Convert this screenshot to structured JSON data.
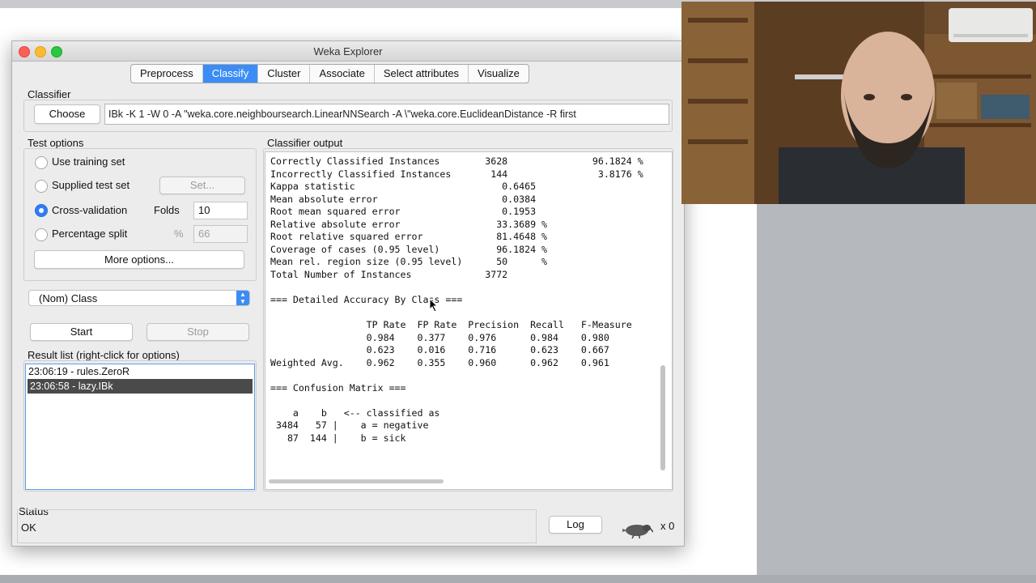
{
  "window": {
    "title": "Weka Explorer"
  },
  "tabs": [
    "Preprocess",
    "Classify",
    "Cluster",
    "Associate",
    "Select attributes",
    "Visualize"
  ],
  "active_tab": "Classify",
  "classifier": {
    "group_label": "Classifier",
    "choose_label": "Choose",
    "command": "IBk -K 1 -W 0 -A \"weka.core.neighboursearch.LinearNNSearch -A \\\"weka.core.EuclideanDistance -R first"
  },
  "test_options": {
    "group_label": "Test options",
    "use_training": "Use training set",
    "supplied_test": "Supplied test set",
    "set_label": "Set...",
    "cross_validation": "Cross-validation",
    "folds_label": "Folds",
    "folds_value": "10",
    "percentage_split": "Percentage split",
    "percent_symbol": "%",
    "percent_value": "66",
    "more_options": "More options...",
    "selected": "cross_validation"
  },
  "class_select": {
    "value": "(Nom) Class"
  },
  "actions": {
    "start": "Start",
    "stop": "Stop"
  },
  "result_list": {
    "label": "Result list (right-click for options)",
    "items": [
      "23:06:19 - rules.ZeroR",
      "23:06:58 - lazy.IBk"
    ],
    "selected_index": 1
  },
  "output": {
    "label": "Classifier output",
    "lines": [
      "Correctly Classified Instances        3628               96.1824 %",
      "Incorrectly Classified Instances       144                3.8176 %",
      "Kappa statistic                          0.6465",
      "Mean absolute error                      0.0384",
      "Root mean squared error                  0.1953",
      "Relative absolute error                 33.3689 %",
      "Root relative squared error             81.4648 %",
      "Coverage of cases (0.95 level)          96.1824 %",
      "Mean rel. region size (0.95 level)      50      %",
      "Total Number of Instances             3772",
      "",
      "=== Detailed Accuracy By Class ===",
      "",
      "                 TP Rate  FP Rate  Precision  Recall   F-Measure",
      "                 0.984    0.377    0.976      0.984    0.980",
      "                 0.623    0.016    0.716      0.623    0.667",
      "Weighted Avg.    0.962    0.355    0.960      0.962    0.961",
      "",
      "=== Confusion Matrix ===",
      "",
      "    a    b   <-- classified as",
      " 3484   57 |    a = negative",
      "   87  144 |    b = sick"
    ]
  },
  "status": {
    "label": "Status",
    "text": "OK"
  },
  "log_label": "Log",
  "task_count": "x 0",
  "colors": {
    "accent": "#3b8cf5",
    "selected_row": "#4a4a4a"
  }
}
